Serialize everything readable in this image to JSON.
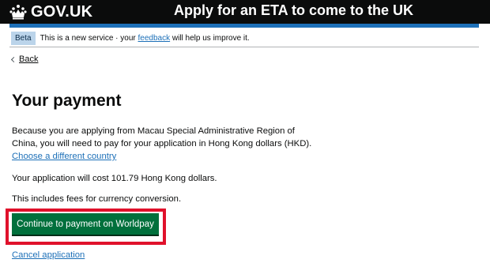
{
  "header": {
    "logo_text": "GOV.UK",
    "service_name": "Apply for an ETA to come to the UK"
  },
  "phase_banner": {
    "tag": "Beta",
    "text_before": "This is a new service · your ",
    "link_text": "feedback",
    "text_after": " will help us improve it."
  },
  "back_link": {
    "label": "Back"
  },
  "main": {
    "title": "Your payment",
    "paragraph1": "Because you are applying from Macau Special Administrative Region of China, you will need to pay for your application in Hong Kong dollars (HKD).",
    "change_country_link": "Choose a different country",
    "paragraph2": "Your application will cost 101.79 Hong Kong dollars.",
    "paragraph3": "This includes fees for currency conversion.",
    "continue_button": "Continue to payment on Worldpay",
    "cancel_link": "Cancel application"
  },
  "colors": {
    "header_bg": "#0b0c0c",
    "accent_blue": "#1d70b8",
    "button_green": "#00703c",
    "highlight_red": "#e0112b"
  },
  "icons": {
    "logo": "crown-icon",
    "back": "chevron-left-icon"
  }
}
